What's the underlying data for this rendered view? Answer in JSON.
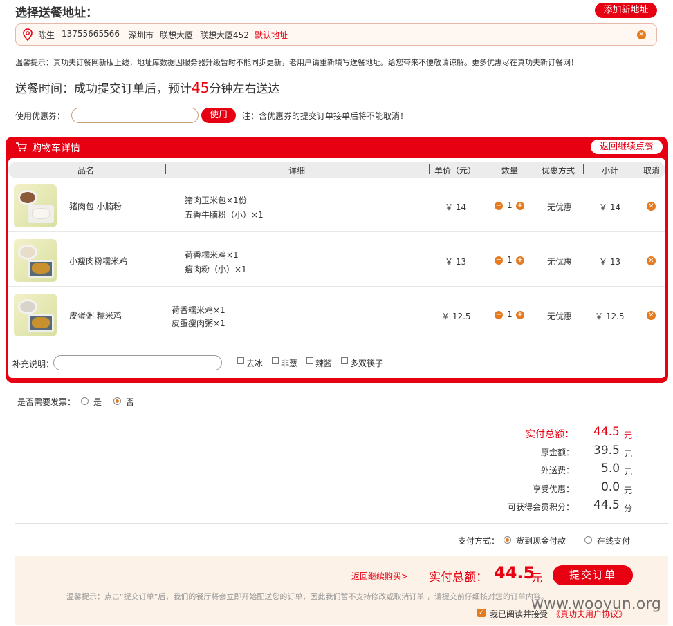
{
  "header": {
    "title": "选择送餐地址：",
    "add_address": "添加新地址"
  },
  "address": {
    "name": "陈生",
    "phone": "13755665566",
    "city": "深圳市",
    "building1": "联想大厦",
    "building2": "联想大厦452",
    "default_link": "默认地址"
  },
  "notice": "温馨提示：真功夫订餐网新版上线，地址库数据因服务器升级暂时不能同步更新，老用户请重新填写送餐地址。给您带来不便敬请谅解。更多优惠尽在真功夫新订餐网！",
  "delivery": {
    "prefix": "送餐时间：成功提交订单后，预计",
    "minutes": "45",
    "suffix": "分钟左右送达"
  },
  "coupon": {
    "label": "使用优惠券：",
    "input_value": "",
    "button": "使用",
    "note": "注：含优惠券的提交订单接单后将不能取消！"
  },
  "cart": {
    "title": "购物车详情",
    "back_button": "返回继续点餐",
    "columns": [
      "品名",
      "详细",
      "单价（元）",
      "数量",
      "优惠方式",
      "小计",
      "取消"
    ],
    "items": [
      {
        "name": "猪肉包 小腩粉",
        "detail1": "猪肉玉米包×1份",
        "detail2": "五香牛腩粉（小）×1",
        "price": "￥ 14",
        "qty": "1",
        "discount": "无优惠",
        "subtotal": "￥ 14"
      },
      {
        "name": "小瘦肉粉糯米鸡",
        "detail1": "荷香糯米鸡×1",
        "detail2": "瘦肉粉（小）×1",
        "price": "￥ 13",
        "qty": "1",
        "discount": "无优惠",
        "subtotal": "￥ 13"
      },
      {
        "name": "皮蛋粥 糯米鸡",
        "detail1": "荷香糯米鸡×1",
        "detail2": "皮蛋瘦肉粥×1",
        "price": "￥ 12.5",
        "qty": "1",
        "discount": "无优惠",
        "subtotal": "￥ 12.5"
      }
    ],
    "remark_label": "补充说明：",
    "remark_value": "",
    "options": [
      "去冰",
      "非葱",
      "辣酱",
      "多双筷子"
    ]
  },
  "invoice": {
    "label": "是否需要发票：",
    "yes": "是",
    "no": "否",
    "selected": "否"
  },
  "summary": {
    "actual_label": "实付总额：",
    "actual": "44.5",
    "actual_unit": "元",
    "original_label": "原金额：",
    "original": "39.5",
    "original_unit": "元",
    "delivery_label": "外送费：",
    "delivery_fee": "5.0",
    "delivery_unit": "元",
    "discount_label": "享受优惠：",
    "discount": "0.0",
    "discount_unit": "元",
    "points_label": "可获得会员积分：",
    "points": "44.5",
    "points_unit": "分"
  },
  "payment": {
    "label": "支付方式：",
    "cash": "货到现金付款",
    "online": "在线支付",
    "selected": "货到现金付款"
  },
  "footer": {
    "back_link": "返回继续购买>",
    "total_label": "实付总额：",
    "total": "44.5",
    "total_unit": "元",
    "submit": "提交订单",
    "tip": "温馨提示：点击“提交订单”后，我们的餐厅将会立即开始配送您的订单，因此我们暂不支持修改或取消订单 ，请提交前仔细核对您的订单内容。",
    "agree_text": "我已阅读并接受",
    "agreement_link": "《真功夫用户协议》",
    "watermark": "www.wooyun.org"
  },
  "colors": {
    "brand": "#e60012",
    "accent": "#e57b1e"
  }
}
